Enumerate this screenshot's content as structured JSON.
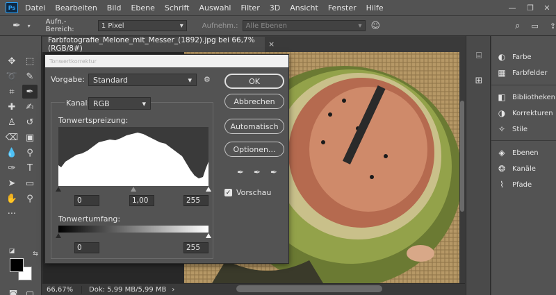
{
  "menubar": {
    "app_icon": "Ps",
    "items": [
      "Datei",
      "Bearbeiten",
      "Bild",
      "Ebene",
      "Schrift",
      "Auswahl",
      "Filter",
      "3D",
      "Ansicht",
      "Fenster",
      "Hilfe"
    ],
    "window_controls": [
      "minimize-icon",
      "maximize-icon",
      "close-icon"
    ]
  },
  "options_bar": {
    "tool_icon": "eyedropper-icon",
    "sample_size_label": "Aufn.-Bereich:",
    "sample_size_value": "1 Pixel",
    "sample_label": "Aufnehm.:",
    "sample_value": "Alle Ebenen",
    "right_icons": [
      "search-icon",
      "workspace-icon",
      "share-icon"
    ]
  },
  "document": {
    "tab_title": "Farbfotografie_Melone_mit_Messer_(1892).jpg bei 66,7% (RGB/8#)",
    "close_glyph": "×"
  },
  "status_bar": {
    "zoom": "66,67%",
    "doc_size": "Dok: 5,99 MB/5,99 MB",
    "arrow": "›"
  },
  "panels": {
    "items": [
      {
        "label": "Farbe",
        "icon": "color-wheel-icon"
      },
      {
        "label": "Farbfelder",
        "icon": "swatches-grid-icon"
      },
      {
        "label": "Bibliotheken",
        "icon": "libraries-icon"
      },
      {
        "label": "Korrekturen",
        "icon": "adjustments-icon"
      },
      {
        "label": "Stile",
        "icon": "styles-icon"
      },
      {
        "label": "Ebenen",
        "icon": "layers-icon"
      },
      {
        "label": "Kanäle",
        "icon": "channels-icon"
      },
      {
        "label": "Pfade",
        "icon": "paths-icon"
      }
    ]
  },
  "levels_dialog": {
    "title": "Tonwertkorrektur",
    "preset_label": "Vorgabe:",
    "preset_value": "Standard",
    "channel_label": "Kanal:",
    "channel_value": "RGB",
    "input_levels_label": "Tonwertspreizung:",
    "input_black": "0",
    "input_gamma": "1,00",
    "input_white": "255",
    "output_levels_label": "Tonwertumfang:",
    "output_black": "0",
    "output_white": "255",
    "buttons": {
      "ok": "OK",
      "cancel": "Abbrechen",
      "auto": "Automatisch",
      "options": "Optionen..."
    },
    "preview_label": "Vorschau",
    "preview_checked": true
  },
  "colors": {
    "foreground": "#000000",
    "background": "#ffffff",
    "ui_dark": "#535353"
  }
}
